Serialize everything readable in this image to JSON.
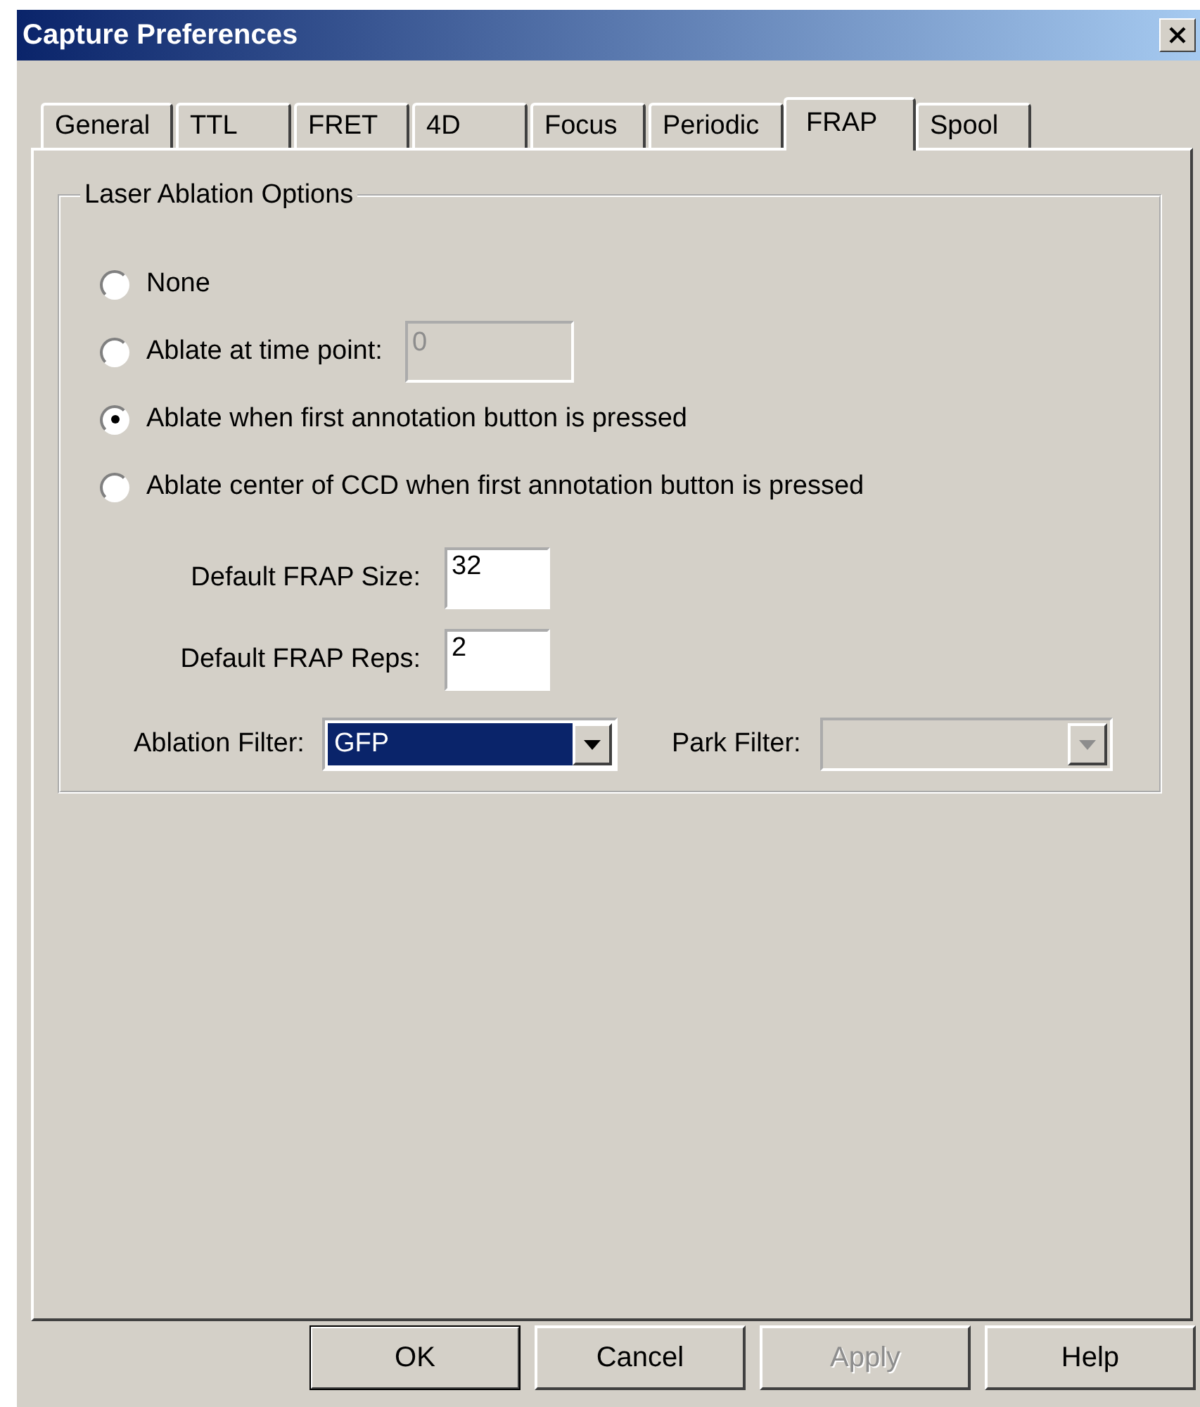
{
  "window": {
    "title": "Capture Preferences"
  },
  "tabs": [
    {
      "label": "General",
      "selected": false
    },
    {
      "label": "TTL",
      "selected": false
    },
    {
      "label": "FRET",
      "selected": false
    },
    {
      "label": "4D",
      "selected": false
    },
    {
      "label": "Focus",
      "selected": false
    },
    {
      "label": "Periodic",
      "selected": false
    },
    {
      "label": "FRAP",
      "selected": true
    },
    {
      "label": "Spool",
      "selected": false
    }
  ],
  "group": {
    "title": "Laser Ablation Options",
    "options": [
      {
        "label": "None",
        "selected": false
      },
      {
        "label": "Ablate at time point:",
        "selected": false,
        "field": {
          "value": "0",
          "disabled": true
        }
      },
      {
        "label": "Ablate when first annotation button is pressed",
        "selected": true
      },
      {
        "label": "Ablate center of CCD when first annotation button is pressed",
        "selected": false
      }
    ],
    "fields": [
      {
        "label": "Default FRAP Size:",
        "value": "32"
      },
      {
        "label": "Default FRAP Reps:",
        "value": "2"
      }
    ],
    "filters": [
      {
        "label": "Ablation Filter:",
        "value": "GFP",
        "disabled": false
      },
      {
        "label": "Park Filter:",
        "disabled": true
      }
    ]
  },
  "buttons": [
    {
      "label": "OK",
      "default": true,
      "disabled": false
    },
    {
      "label": "Cancel",
      "default": false,
      "disabled": false
    },
    {
      "label": "Apply",
      "default": false,
      "disabled": true
    },
    {
      "label": "Help",
      "default": false,
      "disabled": false
    }
  ]
}
